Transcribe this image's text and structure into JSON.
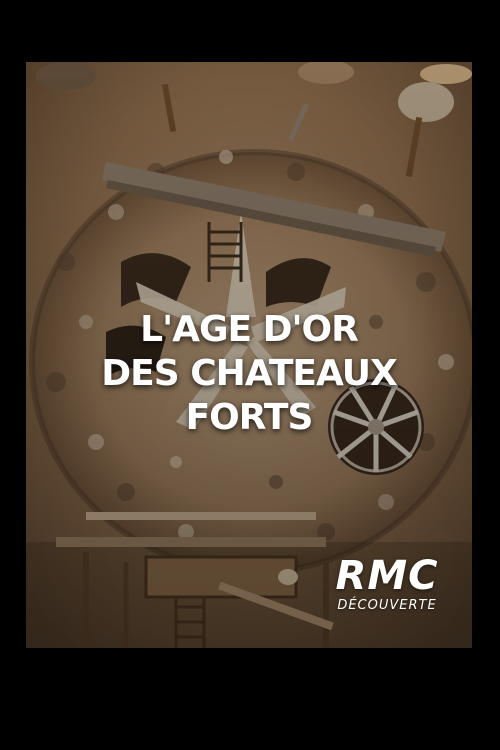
{
  "poster": {
    "title_lines": [
      "L'AGE D'OR",
      "DES CHATEAUX",
      "FORTS"
    ],
    "logo": {
      "main": "RMC",
      "sub": "DÉCOUVERTE"
    }
  },
  "colors": {
    "background": "#000000",
    "ground": "#8a6a4a",
    "stone_light": "#c9b79f",
    "stone_dark": "#5a4330",
    "timber": "#7a5a3a",
    "title_text": "#ffffff"
  }
}
